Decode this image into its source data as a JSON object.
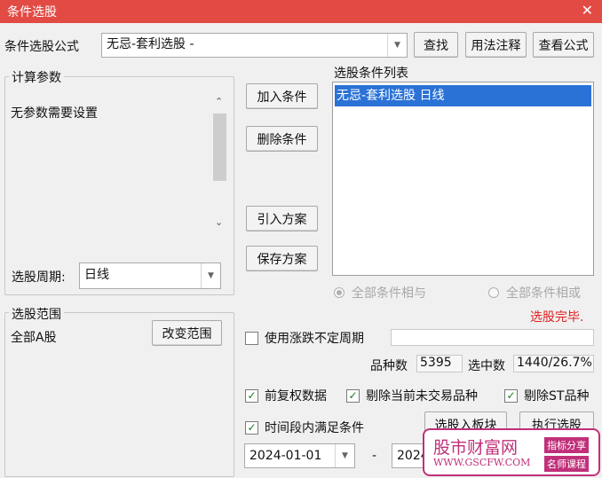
{
  "window": {
    "title": "条件选股",
    "close_glyph": "✕"
  },
  "formula": {
    "label": "条件选股公式",
    "value": "无忌-套利选股  -",
    "find_button": "查找",
    "usage_button": "用法注释",
    "view_button": "查看公式"
  },
  "params": {
    "group_label": "计算参数",
    "text": "无参数需要设置",
    "period_label": "选股周期:",
    "period_value": "日线"
  },
  "actions": {
    "add": "加入条件",
    "delete": "删除条件",
    "import": "引入方案",
    "save": "保存方案"
  },
  "conditions": {
    "label": "选股条件列表",
    "items": [
      "无忌-套利选股  日线"
    ],
    "radio_and": "全部条件相与",
    "radio_or": "全部条件相或"
  },
  "status": {
    "text": "选股完毕.",
    "color": "#e02020"
  },
  "scope": {
    "group_label": "选股范围",
    "value": "全部A股",
    "change_button": "改变范围"
  },
  "options": {
    "use_unfixed_period": "使用涨跌不定周期",
    "count_label": "品种数",
    "count_value": "5395",
    "selected_label": "选中数",
    "selected_value": "1440/26.7%",
    "pre_adjust": "前复权数据",
    "remove_not_traded": "剔除当前未交易品种",
    "remove_st": "剔除ST品种",
    "time_range": "时间段内满足条件",
    "to_block_button": "选股入板块",
    "execute_button": "执行选股",
    "date_from": "2024-01-01",
    "date_sep": "-",
    "date_to": "2024"
  },
  "watermark": {
    "site_name": "股市财富网",
    "site_url": "WWW.GSCFW.COM",
    "tag1": "指标分享",
    "tag2": "名师课程"
  }
}
